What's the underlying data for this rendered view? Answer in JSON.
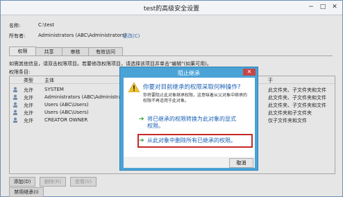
{
  "window": {
    "title": "test的高级安全设置",
    "controls": [
      "−",
      "□",
      "✕"
    ]
  },
  "info": {
    "name_label": "名称:",
    "name_value": "C:\\test",
    "owner_label": "所有者:",
    "owner_value": "Administrators (ABC\\Administrators)",
    "owner_change": "更改(C)"
  },
  "tabs": [
    "权限",
    "共享",
    "审核",
    "有效访问"
  ],
  "hint_text": "如需其他信息，请双击权限项目。若要修改权限项目，请选择该项目并单击\"编辑\"(如果可用)。",
  "list_label": "权限条目:",
  "columns": {
    "type": "类型",
    "principal": "主体",
    "applies": "于"
  },
  "entries": [
    {
      "type": "允许",
      "principal": "SYSTEM",
      "applies": "此文件夹、子文件夹和文件"
    },
    {
      "type": "允许",
      "principal": "Administrators (ABC\\Administrat...",
      "applies": "此文件夹、子文件夹和文件"
    },
    {
      "type": "允许",
      "principal": "Users (ABC\\Users)",
      "applies": "此文件夹、子文件夹和文件"
    },
    {
      "type": "允许",
      "principal": "Users (ABC\\Users)",
      "applies": "此文件夹和子文件夹"
    },
    {
      "type": "允许",
      "principal": "CREATOR OWNER",
      "applies": "仅子文件夹和文件"
    }
  ],
  "buttons": {
    "add": "添加(D)",
    "remove": "删除(R)",
    "view": "查看(V)",
    "disable_inherit": "禁用继承(I)"
  },
  "dialog": {
    "title": "阻止继承",
    "close": "✕",
    "question": "你要对目前继承的权限采取何种操作?",
    "description": "你将要阻止此对象继承权限，这意味着从父对象中继承的权限不再适用于此对象。",
    "option1": "将已继承的权限转换为此对象的显式权限。",
    "option2": "从此对象中删除所有已继承的权限。",
    "arrow": "➔",
    "cancel": "取消"
  }
}
